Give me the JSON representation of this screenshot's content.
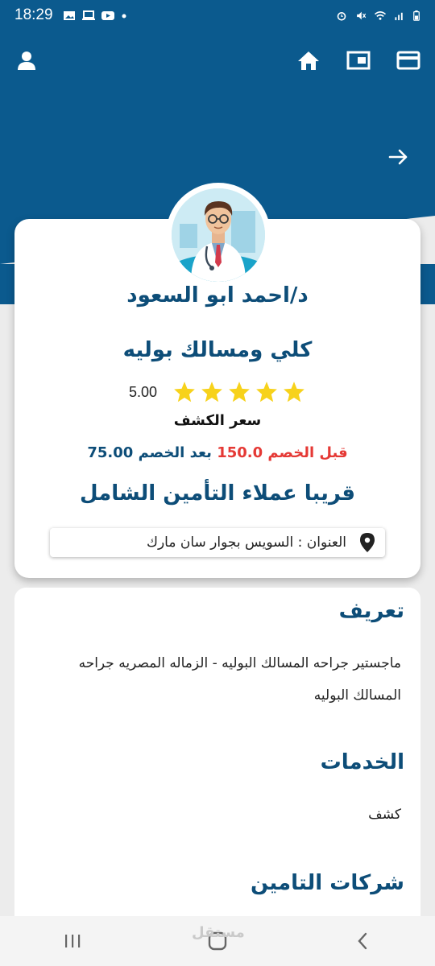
{
  "status_bar": {
    "time": "18:29"
  },
  "doctor": {
    "name": "د/احمد ابو السعود",
    "specialty": "كلي ومسالك بوليه",
    "rating": "5.00",
    "stars": 5,
    "price_label": "سعر الكشف",
    "price_before": "قبل الخصم 150.0",
    "price_after": "بعد الخصم 75.00",
    "insurance_note": "قريبا عملاء التأمين الشامل",
    "address": "العنوان : السويس بجوار سان مارك"
  },
  "sections": {
    "about_title": "تعريف",
    "about_body": "ماجستير جراحه المسالك البوليه - الزماله المصريه جراحه المسالك البوليه",
    "services_title": "الخدمات",
    "services_body": "كشف",
    "insurance_title": "شركات التامين"
  },
  "watermark": "مستقل",
  "colors": {
    "primary": "#0b5a8e",
    "title": "#0d4d78",
    "discount_before": "#e53935",
    "star": "#f7d21b"
  }
}
